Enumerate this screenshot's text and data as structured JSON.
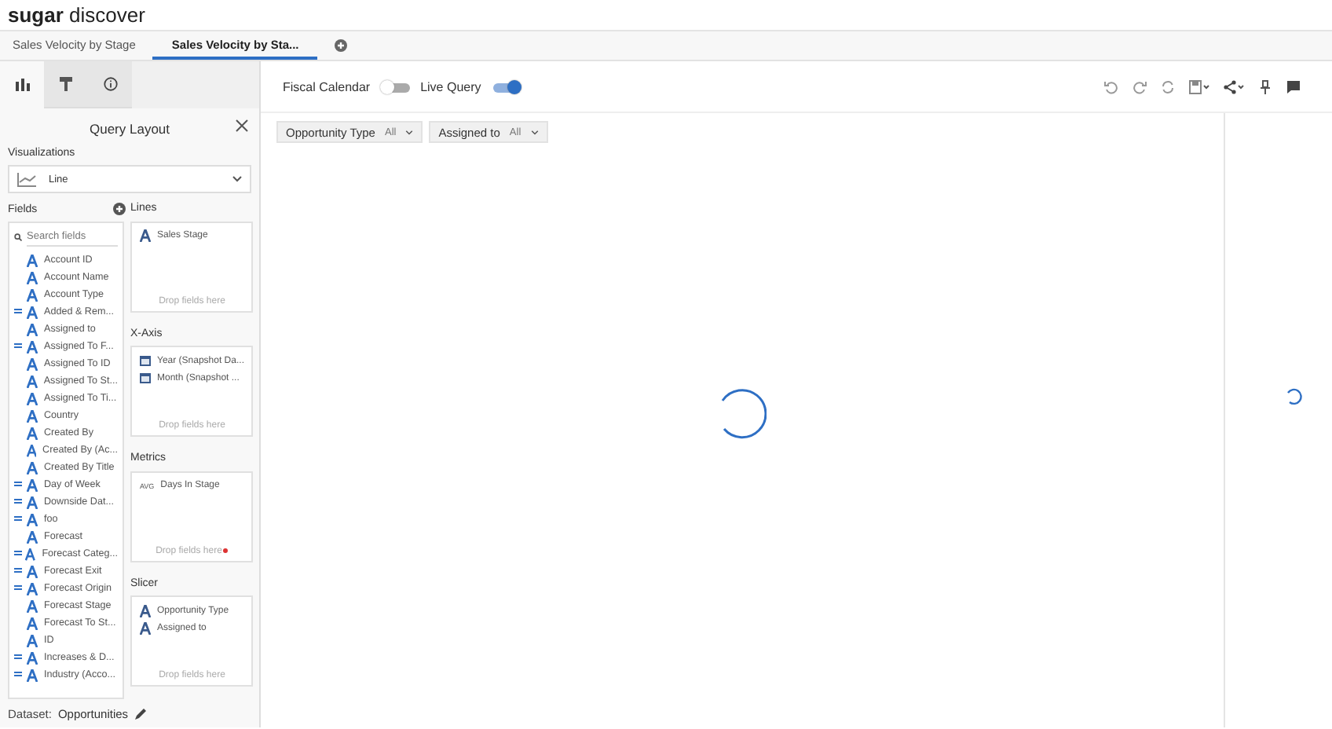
{
  "app": {
    "brand_bold": "sugar",
    "brand_rest": "discover"
  },
  "tabs": [
    {
      "label": "Sales Velocity by Stage",
      "selected": false
    },
    {
      "label": "Sales Velocity by Sta...",
      "selected": true
    }
  ],
  "panel_tabs": [
    {
      "kind": "chart",
      "selected": true
    },
    {
      "kind": "format",
      "selected": false
    },
    {
      "kind": "info",
      "selected": false
    }
  ],
  "panel": {
    "title": "Query Layout",
    "visualizations_label": "Visualizations",
    "visualization": "Line",
    "fields_label": "Fields",
    "search_placeholder": "Search fields",
    "fields": [
      {
        "name": "Account ID",
        "calculated": false
      },
      {
        "name": "Account Name",
        "calculated": false
      },
      {
        "name": "Account Type",
        "calculated": false
      },
      {
        "name": "Added & Rem...",
        "calculated": true
      },
      {
        "name": "Assigned to",
        "calculated": false
      },
      {
        "name": "Assigned To F...",
        "calculated": true
      },
      {
        "name": "Assigned To ID",
        "calculated": false
      },
      {
        "name": "Assigned To St...",
        "calculated": false
      },
      {
        "name": "Assigned To Ti...",
        "calculated": false
      },
      {
        "name": "Country",
        "calculated": false
      },
      {
        "name": "Created By",
        "calculated": false
      },
      {
        "name": "Created By (Ac...",
        "calculated": false
      },
      {
        "name": "Created By Title",
        "calculated": false
      },
      {
        "name": "Day of Week",
        "calculated": true
      },
      {
        "name": "Downside Dat...",
        "calculated": true
      },
      {
        "name": "foo",
        "calculated": true
      },
      {
        "name": "Forecast",
        "calculated": false
      },
      {
        "name": "Forecast Categ...",
        "calculated": true
      },
      {
        "name": "Forecast Exit",
        "calculated": true
      },
      {
        "name": "Forecast Origin",
        "calculated": true
      },
      {
        "name": "Forecast Stage",
        "calculated": false
      },
      {
        "name": "Forecast To St...",
        "calculated": false
      },
      {
        "name": "ID",
        "calculated": false
      },
      {
        "name": "Increases & D...",
        "calculated": true
      },
      {
        "name": "Industry (Acco...",
        "calculated": true
      }
    ],
    "zones": [
      {
        "label": "Lines",
        "items": [
          {
            "kind": "text",
            "name": "Sales Stage"
          }
        ],
        "drop_hint": "Drop fields here",
        "required": false
      },
      {
        "label": "X-Axis",
        "items": [
          {
            "kind": "date",
            "name": "Year (Snapshot Da..."
          },
          {
            "kind": "date",
            "name": "Month (Snapshot ..."
          }
        ],
        "drop_hint": "Drop fields here",
        "required": false
      },
      {
        "label": "Metrics",
        "items": [
          {
            "kind": "avg",
            "badge": "AVG",
            "name": "Days In Stage"
          }
        ],
        "drop_hint": "Drop fields here",
        "required": true
      },
      {
        "label": "Slicer",
        "items": [
          {
            "kind": "text",
            "name": "Opportunity Type"
          },
          {
            "kind": "text",
            "name": "Assigned to"
          }
        ],
        "drop_hint": "Drop fields here",
        "required": false
      }
    ],
    "dataset_label": "Dataset:",
    "dataset": "Opportunities"
  },
  "toggles": [
    {
      "label": "Fiscal Calendar",
      "on": false
    },
    {
      "label": "Live Query",
      "on": true
    }
  ],
  "filters": [
    {
      "label": "Opportunity Type",
      "value": "All"
    },
    {
      "label": "Assigned to",
      "value": "All"
    }
  ]
}
